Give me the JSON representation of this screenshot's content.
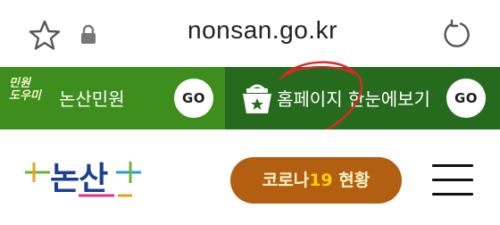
{
  "browser": {
    "url": "nonsan.go.kr",
    "icons": [
      "star-icon",
      "lock-icon",
      "reload-icon"
    ]
  },
  "banner": {
    "left": {
      "logo_lines": [
        "민원",
        "도우미"
      ],
      "label": "논산민원",
      "go_label": "GO",
      "color": "#3e8e1e"
    },
    "right": {
      "icon": "basket-icon",
      "label": "홈페이지 한눈에보기",
      "go_label": "GO",
      "color": "#266b1d"
    }
  },
  "header": {
    "logo_text": "논산",
    "corona_button": {
      "label_prefix": "코로나",
      "label_number": "19",
      "label_suffix": " 현황",
      "color": "#b25f12"
    },
    "menu_icon": "hamburger-icon"
  },
  "annotation": {
    "color": "#e0262b"
  }
}
